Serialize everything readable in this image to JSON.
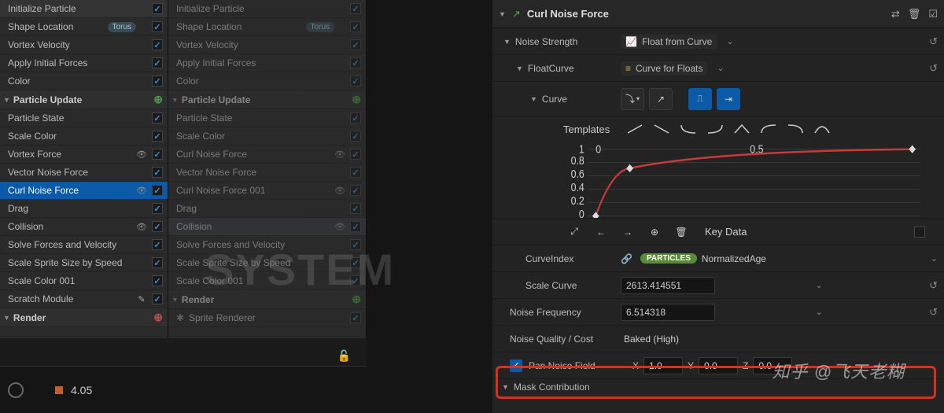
{
  "header": {
    "title": "Curl Noise Force"
  },
  "left_panel": {
    "groups": [
      {
        "items": [
          {
            "label": "Initialize Particle",
            "checked": true
          },
          {
            "label": "Shape Location",
            "pill": "Torus",
            "checked": true
          },
          {
            "label": "Vortex Velocity",
            "checked": true
          },
          {
            "label": "Apply Initial Forces",
            "checked": true
          },
          {
            "label": "Color",
            "checked": true
          }
        ]
      },
      {
        "header": "Particle Update",
        "add_color": "green",
        "items": [
          {
            "label": "Particle State",
            "checked": true
          },
          {
            "label": "Scale Color",
            "checked": true
          },
          {
            "label": "Vortex Force",
            "eye": true,
            "checked": true
          },
          {
            "label": "Vector Noise Force",
            "checked": true
          },
          {
            "label": "Curl Noise Force",
            "eye": true,
            "checked": true,
            "selected": true
          },
          {
            "label": "Drag",
            "checked": true
          },
          {
            "label": "Collision",
            "eye": true,
            "checked": true
          },
          {
            "label": "Solve Forces and Velocity",
            "checked": true
          },
          {
            "label": "Scale Sprite Size by Speed",
            "checked": true
          },
          {
            "label": "Scale Color 001",
            "checked": true
          },
          {
            "label": "Scratch Module",
            "scratch": true,
            "checked": true
          }
        ]
      },
      {
        "header": "Render",
        "add_color": "red",
        "items": []
      }
    ]
  },
  "mid_panel": {
    "groups": [
      {
        "items": [
          {
            "label": "Initialize Particle",
            "checked": true
          },
          {
            "label": "Shape Location",
            "pill": "Torus",
            "checked": true
          },
          {
            "label": "Vortex Velocity",
            "checked": true
          },
          {
            "label": "Apply Initial Forces",
            "checked": true
          },
          {
            "label": "Color",
            "checked": true
          }
        ]
      },
      {
        "header": "Particle Update",
        "add_color": "green",
        "items": [
          {
            "label": "Particle State",
            "checked": true
          },
          {
            "label": "Scale Color",
            "checked": true
          },
          {
            "label": "Curl Noise Force",
            "eye": true,
            "checked": true
          },
          {
            "label": "Vector Noise Force",
            "checked": true
          },
          {
            "label": "Curl Noise Force 001",
            "eye": true,
            "checked": true
          },
          {
            "label": "Drag",
            "checked": true
          },
          {
            "label": "Collision",
            "eye": true,
            "checked": true,
            "subtle_sel": true
          },
          {
            "label": "Solve Forces and Velocity",
            "checked": true
          },
          {
            "label": "Scale Sprite Size by Speed",
            "checked": true
          },
          {
            "label": "Scale Color 001",
            "checked": true
          }
        ]
      },
      {
        "header": "Render",
        "add_color": "green",
        "items": [
          {
            "label": "Sprite Renderer",
            "sprite": true,
            "checked": true
          }
        ]
      }
    ]
  },
  "bottom": {
    "value": "4.05"
  },
  "props": {
    "noise_strength": {
      "label": "Noise Strength",
      "value": "Float from Curve"
    },
    "float_curve": {
      "label": "FloatCurve",
      "value": "Curve for Floats"
    },
    "curve": {
      "label": "Curve",
      "templates_label": "Templates",
      "key_data_label": "Key Data"
    },
    "curve_index": {
      "label": "CurveIndex",
      "pill": "PARTICLES",
      "value": "NormalizedAge"
    },
    "scale_curve": {
      "label": "Scale Curve",
      "value": "2613.414551"
    },
    "noise_freq": {
      "label": "Noise Frequency",
      "value": "6.514318"
    },
    "noise_quality": {
      "label": "Noise Quality / Cost",
      "value": "Baked (High)"
    },
    "pan_noise": {
      "label": "Pan Noise Field",
      "checked": true,
      "x": "1.0",
      "y": "0.0",
      "z": "0.0"
    },
    "mask": {
      "label": "Mask Contribution"
    }
  },
  "chart_data": {
    "type": "line",
    "title": "",
    "xlabel": "",
    "ylabel": "",
    "xlim": [
      0,
      1
    ],
    "ylim": [
      0,
      1
    ],
    "x_ticks": [
      0,
      0.5
    ],
    "y_ticks": [
      0,
      0.2,
      0.4,
      0.6,
      0.8,
      1
    ],
    "series": [
      {
        "name": "curve",
        "points": [
          [
            0.0,
            0.0
          ],
          [
            0.1,
            0.7
          ],
          [
            0.25,
            0.9
          ],
          [
            0.5,
            0.97
          ],
          [
            1.0,
            1.0
          ]
        ]
      }
    ],
    "keys": [
      [
        0.0,
        0.0
      ],
      [
        0.1,
        0.7
      ],
      [
        1.0,
        1.0
      ]
    ]
  },
  "watermark_main": "SYSTEM",
  "watermark_zhihu": "知乎 @飞天老糊"
}
